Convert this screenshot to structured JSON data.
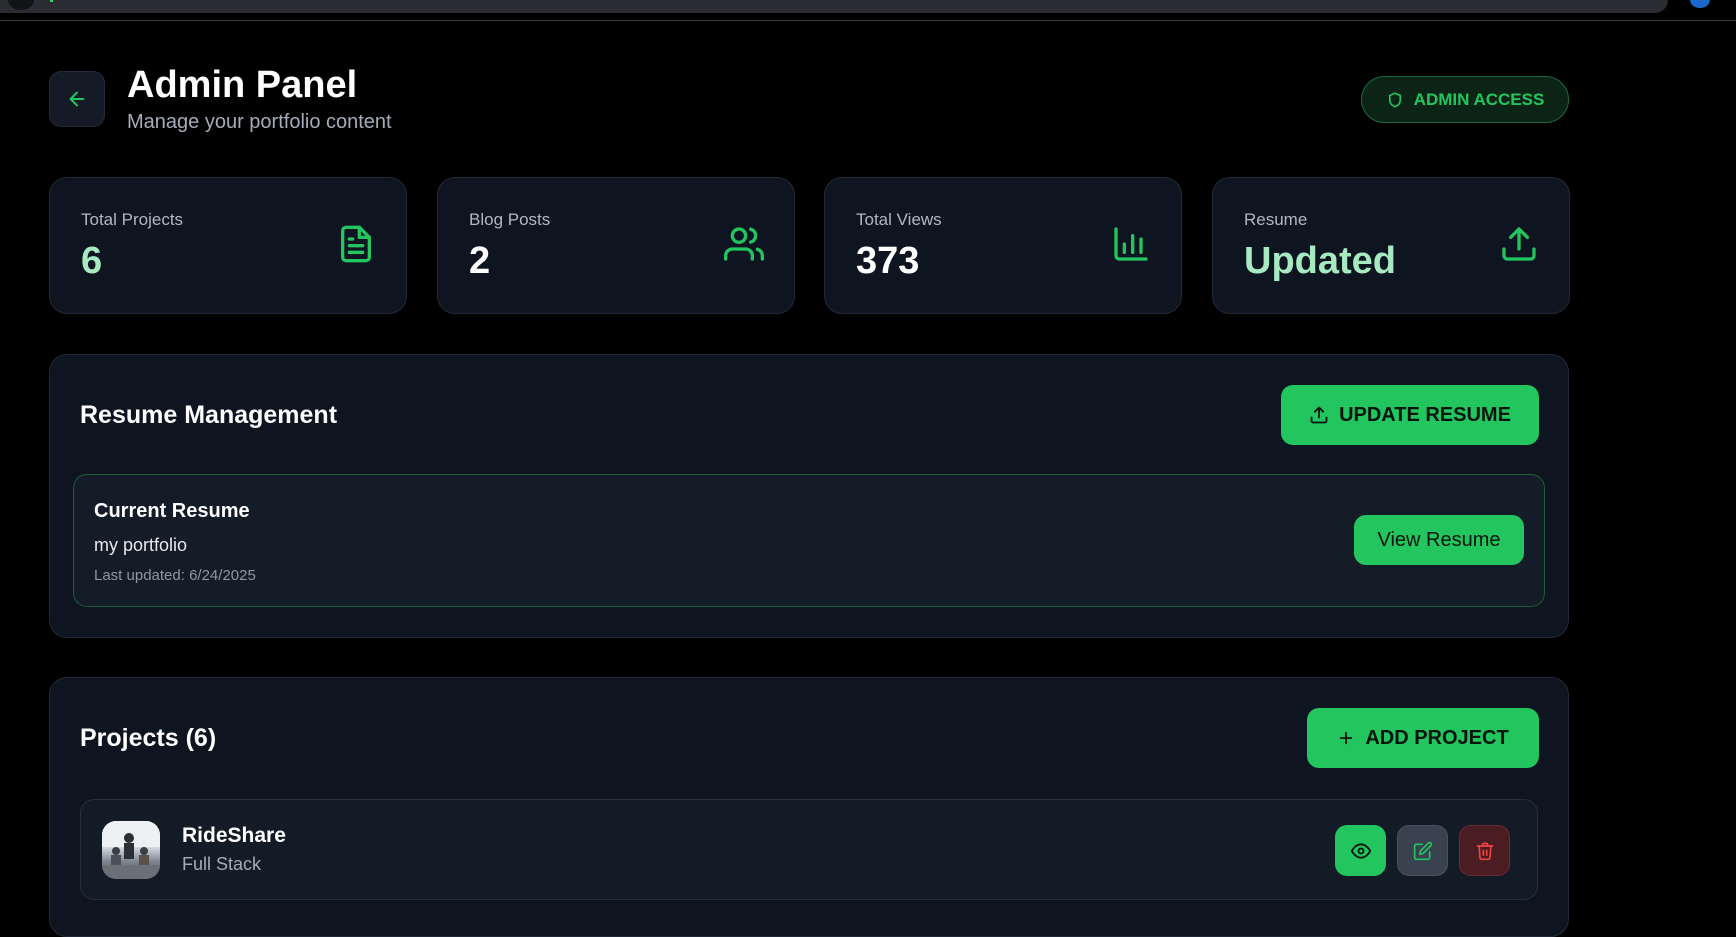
{
  "header": {
    "title": "Admin Panel",
    "subtitle": "Manage your portfolio content",
    "badge": "ADMIN ACCESS"
  },
  "stats": [
    {
      "label": "Total Projects",
      "value": "6",
      "icon": "document-icon"
    },
    {
      "label": "Blog Posts",
      "value": "2",
      "icon": "users-icon"
    },
    {
      "label": "Total Views",
      "value": "373",
      "icon": "bar-chart-icon"
    },
    {
      "label": "Resume",
      "value": "Updated",
      "icon": "upload-icon"
    }
  ],
  "resume": {
    "section_title": "Resume Management",
    "update_label": "UPDATE RESUME",
    "card_title": "Current Resume",
    "name": "my portfolio",
    "last_updated": "Last updated: 6/24/2025",
    "view_label": "View Resume"
  },
  "projects": {
    "section_title": "Projects (6)",
    "add_label": "ADD PROJECT",
    "items": [
      {
        "name": "RideShare",
        "category": "Full Stack"
      }
    ]
  },
  "colors": {
    "accent": "#22c55e",
    "background": "#000000",
    "card": "#0e1420",
    "danger": "#ef4444"
  }
}
